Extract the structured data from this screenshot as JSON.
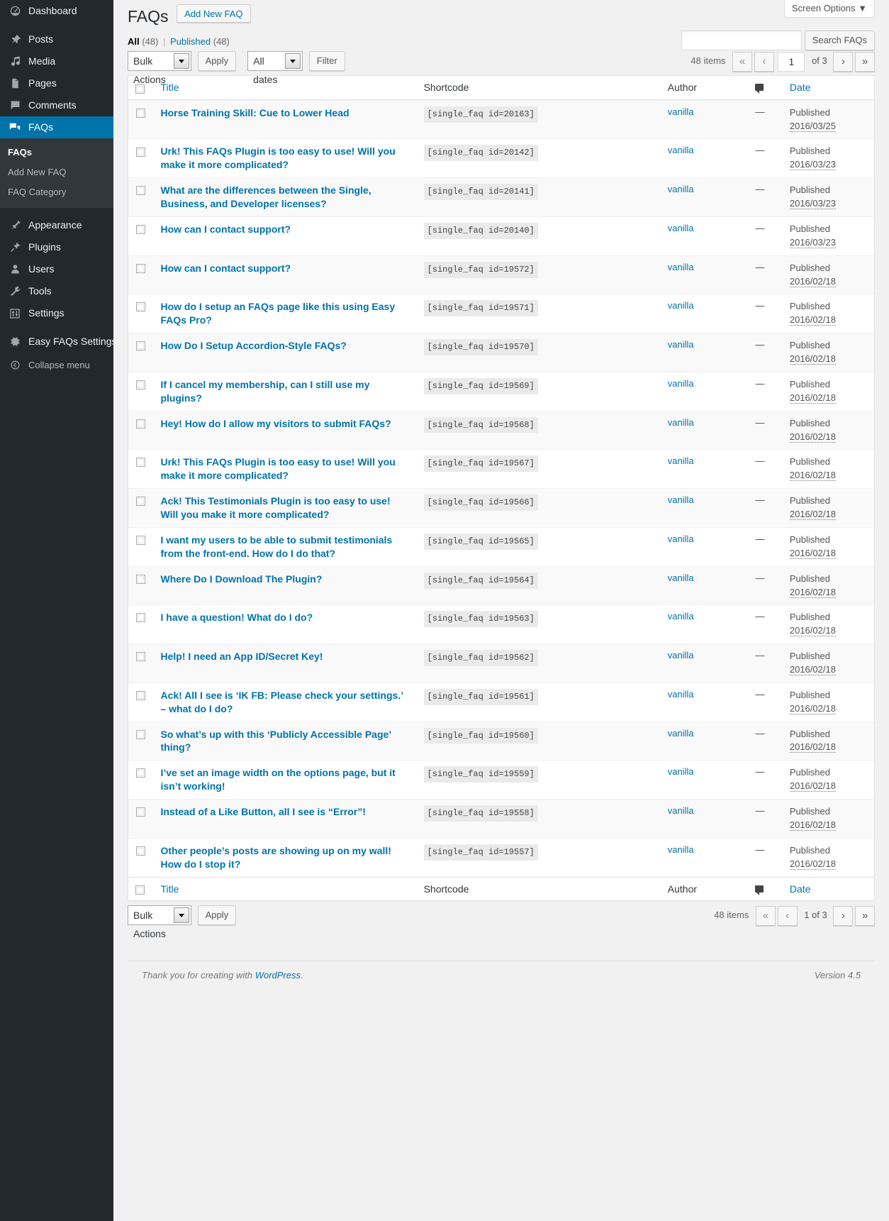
{
  "sidebar": {
    "items": [
      {
        "label": "Dashboard",
        "icon": "dashboard-icon"
      },
      {
        "label": "Posts",
        "icon": "pin-icon"
      },
      {
        "label": "Media",
        "icon": "media-icon"
      },
      {
        "label": "Pages",
        "icon": "pages-icon"
      },
      {
        "label": "Comments",
        "icon": "comments-icon"
      },
      {
        "label": "FAQs",
        "icon": "faqs-icon"
      }
    ],
    "submenu": [
      {
        "label": "FAQs",
        "current": true
      },
      {
        "label": "Add New FAQ",
        "current": false
      },
      {
        "label": "FAQ Category",
        "current": false
      }
    ],
    "items2": [
      {
        "label": "Appearance",
        "icon": "appearance-icon"
      },
      {
        "label": "Plugins",
        "icon": "plugins-icon"
      },
      {
        "label": "Users",
        "icon": "users-icon"
      },
      {
        "label": "Tools",
        "icon": "tools-icon"
      },
      {
        "label": "Settings",
        "icon": "settings-icon"
      }
    ],
    "items3": [
      {
        "label": "Easy FAQs Settings",
        "icon": "gear-icon"
      }
    ],
    "collapse_label": "Collapse menu"
  },
  "header": {
    "screen_options": "Screen Options",
    "page_title": "FAQs",
    "add_new_label": "Add New FAQ"
  },
  "filters": {
    "all_label": "All",
    "all_count": "(48)",
    "published_label": "Published",
    "published_count": "(48)",
    "separator": "|"
  },
  "search": {
    "value": "",
    "placeholder": "",
    "button_label": "Search FAQs"
  },
  "toolbar": {
    "bulk_actions": "Bulk Actions",
    "apply_label": "Apply",
    "all_dates": "All dates",
    "filter_label": "Filter"
  },
  "pagination_top": {
    "items_text": "48 items",
    "first": "«",
    "prev": "‹",
    "current_page": "1",
    "of_text": "of 3",
    "next": "›",
    "last": "»"
  },
  "pagination_bottom": {
    "items_text": "48 items",
    "first": "«",
    "prev": "‹",
    "paging_text": "1 of 3",
    "next": "›",
    "last": "»"
  },
  "table": {
    "columns": {
      "title": "Title",
      "shortcode": "Shortcode",
      "author": "Author",
      "comments": "comment-icon",
      "date": "Date"
    },
    "rows": [
      {
        "title": "Horse Training Skill: Cue to Lower Head",
        "shortcode": "[single_faq id=20163]",
        "author": "vanilla",
        "comments": "—",
        "status": "Published",
        "date": "2016/03/25"
      },
      {
        "title": "Urk! This FAQs Plugin is too easy to use! Will you make it more complicated?",
        "shortcode": "[single_faq id=20142]",
        "author": "vanilla",
        "comments": "—",
        "status": "Published",
        "date": "2016/03/23"
      },
      {
        "title": "What are the differences between the Single, Business, and Developer licenses?",
        "shortcode": "[single_faq id=20141]",
        "author": "vanilla",
        "comments": "—",
        "status": "Published",
        "date": "2016/03/23"
      },
      {
        "title": "How can I contact support?",
        "shortcode": "[single_faq id=20140]",
        "author": "vanilla",
        "comments": "—",
        "status": "Published",
        "date": "2016/03/23"
      },
      {
        "title": "How can I contact support?",
        "shortcode": "[single_faq id=19572]",
        "author": "vanilla",
        "comments": "—",
        "status": "Published",
        "date": "2016/02/18"
      },
      {
        "title": "How do I setup an FAQs page like this using Easy FAQs Pro?",
        "shortcode": "[single_faq id=19571]",
        "author": "vanilla",
        "comments": "—",
        "status": "Published",
        "date": "2016/02/18"
      },
      {
        "title": "How Do I Setup Accordion-Style FAQs?",
        "shortcode": "[single_faq id=19570]",
        "author": "vanilla",
        "comments": "—",
        "status": "Published",
        "date": "2016/02/18"
      },
      {
        "title": "If I cancel my membership, can I still use my plugins?",
        "shortcode": "[single_faq id=19569]",
        "author": "vanilla",
        "comments": "—",
        "status": "Published",
        "date": "2016/02/18"
      },
      {
        "title": "Hey! How do I allow my visitors to submit FAQs?",
        "shortcode": "[single_faq id=19568]",
        "author": "vanilla",
        "comments": "—",
        "status": "Published",
        "date": "2016/02/18"
      },
      {
        "title": "Urk! This FAQs Plugin is too easy to use! Will you make it more complicated?",
        "shortcode": "[single_faq id=19567]",
        "author": "vanilla",
        "comments": "—",
        "status": "Published",
        "date": "2016/02/18"
      },
      {
        "title": "Ack! This Testimonials Plugin is too easy to use! Will you make it more complicated?",
        "shortcode": "[single_faq id=19566]",
        "author": "vanilla",
        "comments": "—",
        "status": "Published",
        "date": "2016/02/18"
      },
      {
        "title": "I want my users to be able to submit testimonials from the front-end. How do I do that?",
        "shortcode": "[single_faq id=19565]",
        "author": "vanilla",
        "comments": "—",
        "status": "Published",
        "date": "2016/02/18"
      },
      {
        "title": "Where Do I Download The Plugin?",
        "shortcode": "[single_faq id=19564]",
        "author": "vanilla",
        "comments": "—",
        "status": "Published",
        "date": "2016/02/18"
      },
      {
        "title": "I have a question! What do I do?",
        "shortcode": "[single_faq id=19563]",
        "author": "vanilla",
        "comments": "—",
        "status": "Published",
        "date": "2016/02/18"
      },
      {
        "title": "Help! I need an App ID/Secret Key!",
        "shortcode": "[single_faq id=19562]",
        "author": "vanilla",
        "comments": "—",
        "status": "Published",
        "date": "2016/02/18"
      },
      {
        "title": "Ack! All I see is ‘IK FB: Please check your settings.’ – what do I do?",
        "shortcode": "[single_faq id=19561]",
        "author": "vanilla",
        "comments": "—",
        "status": "Published",
        "date": "2016/02/18"
      },
      {
        "title": "So what’s up with this ‘Publicly Accessible Page’ thing?",
        "shortcode": "[single_faq id=19560]",
        "author": "vanilla",
        "comments": "—",
        "status": "Published",
        "date": "2016/02/18"
      },
      {
        "title": "I’ve set an image width on the options page, but it isn’t working!",
        "shortcode": "[single_faq id=19559]",
        "author": "vanilla",
        "comments": "—",
        "status": "Published",
        "date": "2016/02/18"
      },
      {
        "title": "Instead of a Like Button, all I see is “Error”!",
        "shortcode": "[single_faq id=19558]",
        "author": "vanilla",
        "comments": "—",
        "status": "Published",
        "date": "2016/02/18"
      },
      {
        "title": "Other people’s posts are showing up on my wall! How do I stop it?",
        "shortcode": "[single_faq id=19557]",
        "author": "vanilla",
        "comments": "—",
        "status": "Published",
        "date": "2016/02/18"
      }
    ]
  },
  "footer": {
    "thanks_prefix": "Thank you for creating with ",
    "wordpress_link": "WordPress",
    "thanks_suffix": ".",
    "version": "Version 4.5"
  },
  "colors": {
    "accent": "#0073aa",
    "sidebar_bg": "#23282d",
    "submenu_bg": "#32373c",
    "page_bg": "#f1f1f1"
  }
}
